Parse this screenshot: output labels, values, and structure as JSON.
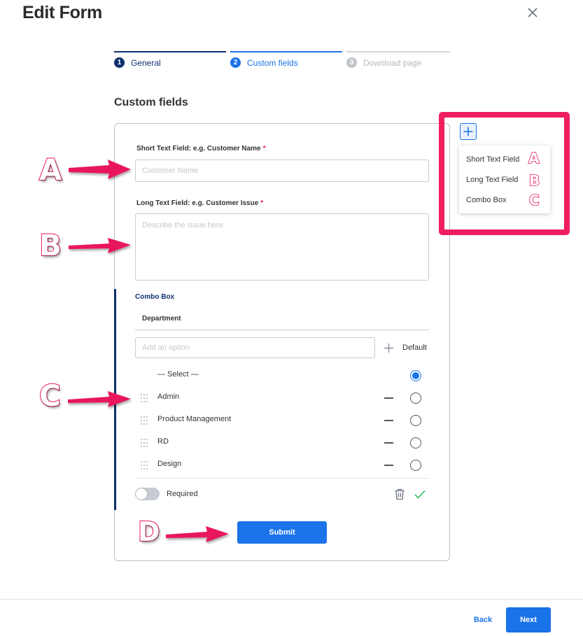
{
  "dialog": {
    "title": "Edit Form"
  },
  "stepper": [
    {
      "num": "1",
      "label": "General",
      "state": "done"
    },
    {
      "num": "2",
      "label": "Custom fields",
      "state": "active"
    },
    {
      "num": "3",
      "label": "Download page",
      "state": "upcoming"
    }
  ],
  "section_title": "Custom fields",
  "short_field": {
    "label": "Short Text Field: e.g. Customer Name",
    "required_mark": "*",
    "placeholder": "Customer Name"
  },
  "long_field": {
    "label": "Long Text Field: e.g. Customer Issue",
    "required_mark": "*",
    "placeholder": "Describe the issue here."
  },
  "combo": {
    "title": "Combo Box",
    "name": "Department",
    "add_placeholder": "Add an option",
    "default_label": "Default",
    "options": [
      {
        "label": "— Select —",
        "default": true,
        "removable": false,
        "draggable": false
      },
      {
        "label": "Admin",
        "default": false,
        "removable": true,
        "draggable": true
      },
      {
        "label": "Product Management",
        "default": false,
        "removable": true,
        "draggable": true
      },
      {
        "label": "RD",
        "default": false,
        "removable": true,
        "draggable": true
      },
      {
        "label": "Design",
        "default": false,
        "removable": true,
        "draggable": true
      }
    ],
    "required_label": "Required",
    "required_on": false
  },
  "submit_label": "Submit",
  "footer": {
    "back_label": "Back",
    "next_label": "Next"
  },
  "field_menu": {
    "items": [
      "Short Text Field",
      "Long Text Field",
      "Combo Box"
    ]
  },
  "annotation": {
    "letters": [
      "A",
      "B",
      "C",
      "D"
    ],
    "color": "#e8175d"
  },
  "colors": {
    "accent": "#1a73e8",
    "navy": "#0e2f6e",
    "required": "#d81f3c",
    "success": "#2eb85c"
  }
}
